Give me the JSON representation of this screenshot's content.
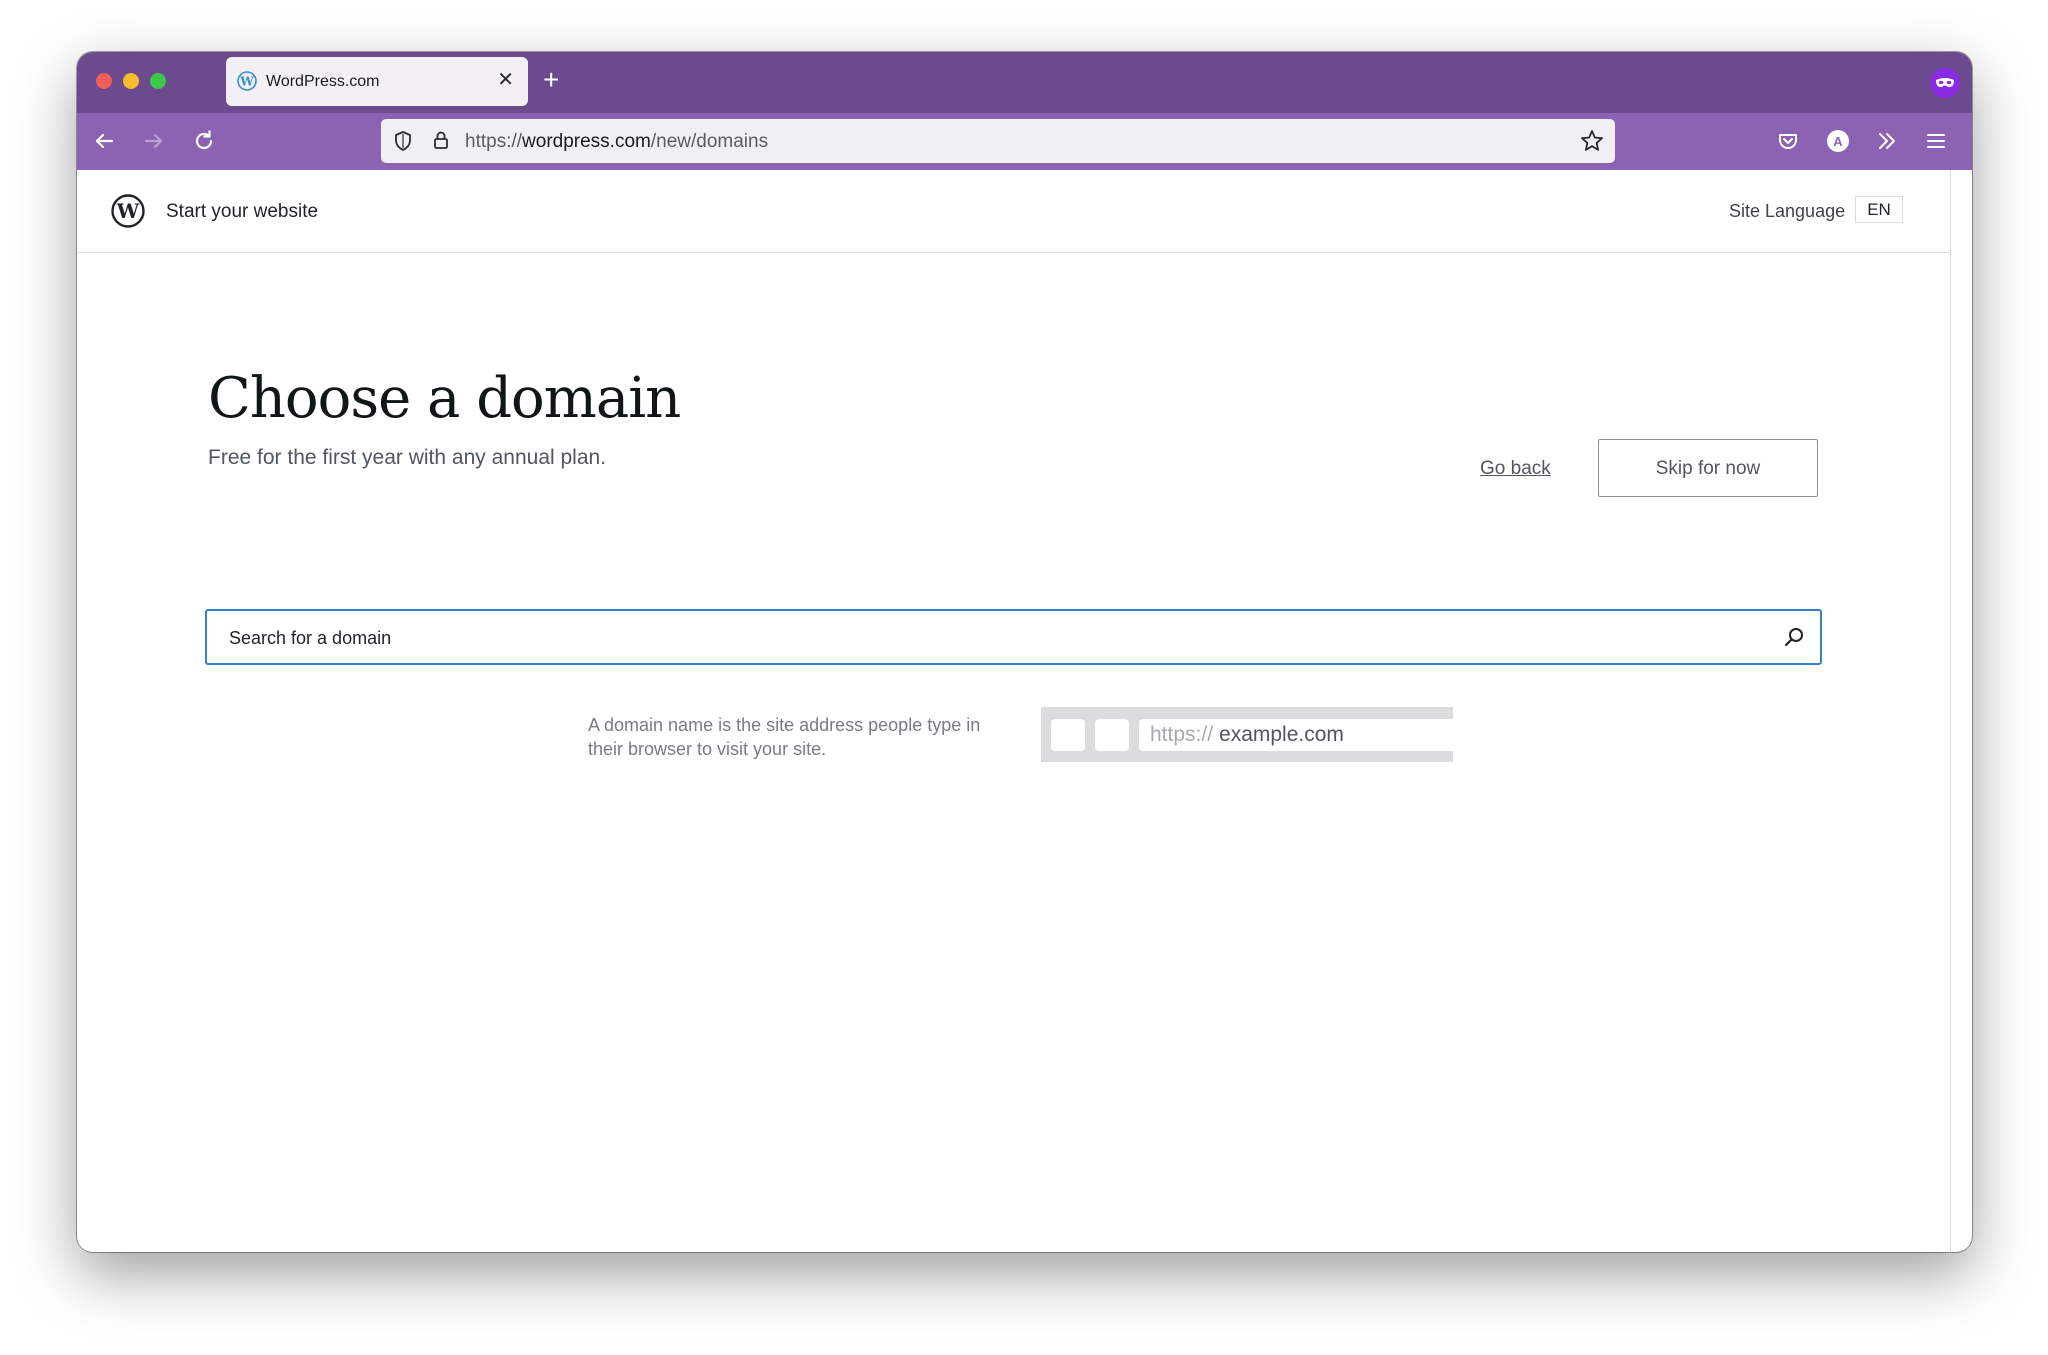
{
  "browser": {
    "tab": {
      "title": "WordPress.com",
      "close_glyph": "✕"
    },
    "new_tab_glyph": "+",
    "url": {
      "prefix": "https://",
      "host": "wordpress.com",
      "path": "/new/domains"
    }
  },
  "header": {
    "brand": "Start your website",
    "site_language_label": "Site Language",
    "site_language_value": "EN"
  },
  "main": {
    "title": "Choose a domain",
    "subtitle": "Free for the first year with any annual plan.",
    "go_back": "Go back",
    "skip": "Skip for now",
    "search_placeholder": "Search for a domain",
    "explanation": "A domain name is the site address people type in their browser to visit your site.",
    "illustration": {
      "protocol": "https://",
      "host": "example.com"
    }
  },
  "colors": {
    "tab_strip": "#6b4a8e",
    "toolbar": "#8c63b2",
    "search_focus": "#3582c4"
  },
  "icons": [
    "wordpress-icon",
    "close-icon",
    "plus-icon",
    "private-mask-icon",
    "back-arrow-icon",
    "forward-arrow-icon",
    "reload-icon",
    "shield-icon",
    "lock-icon",
    "star-icon",
    "pocket-icon",
    "account-icon",
    "chevrons-right-icon",
    "menu-icon",
    "search-icon"
  ]
}
